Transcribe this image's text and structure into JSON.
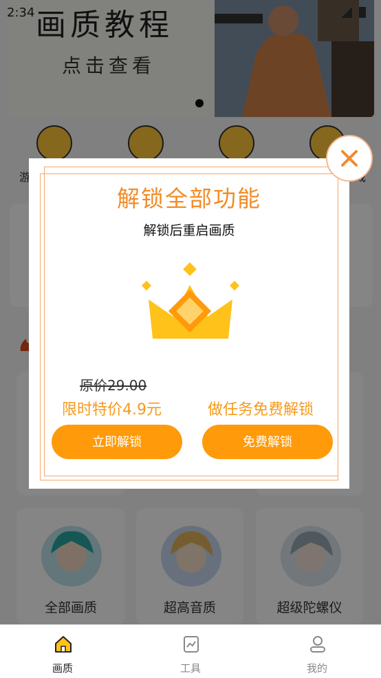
{
  "status_bar": {
    "time": "2:34"
  },
  "banner": {
    "title": "画质教程",
    "subtitle": "点击查看"
  },
  "emoji_row": {
    "labels": [
      "游",
      "",
      "",
      "戏"
    ]
  },
  "grid": {
    "items": [
      {
        "label": "全部画质"
      },
      {
        "label": "超高音质"
      },
      {
        "label": "超级陀螺仪"
      }
    ]
  },
  "modal": {
    "title": "解锁全部功能",
    "subtitle": "解锁后重启画质",
    "original_price": "原价29.00",
    "promo_price": "限时特价4.9元",
    "task_label": "做任务免费解锁",
    "unlock_button": "立即解锁",
    "free_button": "免费解锁",
    "close_icon": "close-icon"
  },
  "nav": {
    "items": [
      {
        "label": "画质",
        "icon": "home-icon",
        "active": true
      },
      {
        "label": "工具",
        "icon": "chart-icon",
        "active": false
      },
      {
        "label": "我的",
        "icon": "user-icon",
        "active": false
      }
    ]
  },
  "colors": {
    "accent": "#ff9a0a",
    "title": "#f28c28",
    "frame": "#f7a66a"
  }
}
